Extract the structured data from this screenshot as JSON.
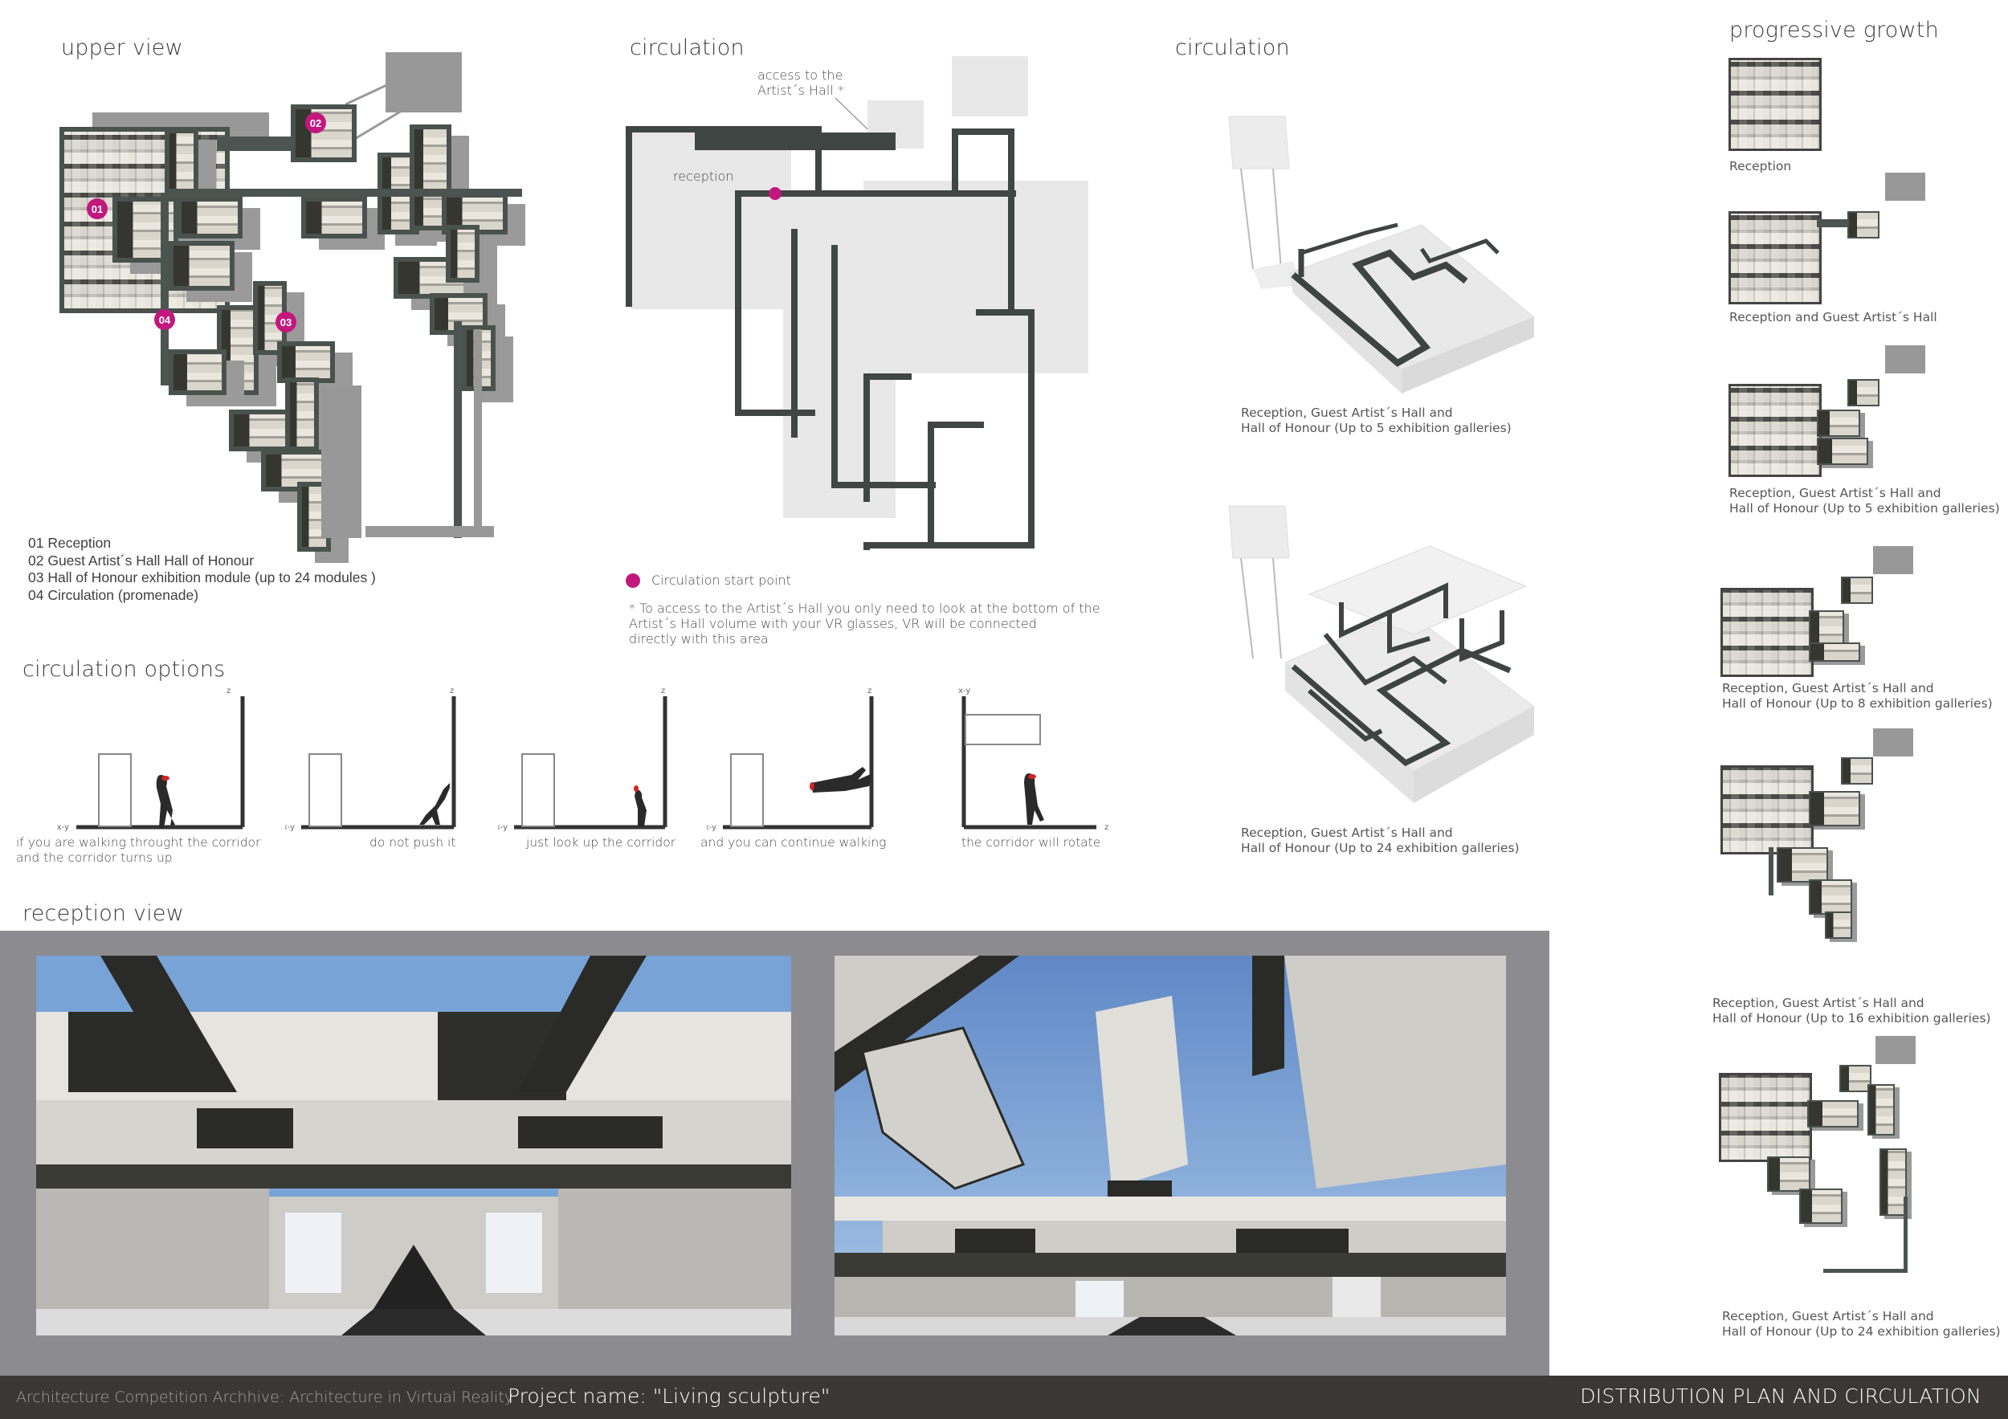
{
  "board": {
    "competition": "Architecture Competition Archhive: Architecture in Virtual Reality",
    "project_name": "Project name: \"Living sculpture\"",
    "sheet_title": "DISTRIBUTION PLAN AND CIRCULATION"
  },
  "upper_view": {
    "title": "upper view",
    "badges": [
      "01",
      "02",
      "03",
      "04"
    ],
    "legend": [
      "01 Reception",
      "02 Guest Artist´s Hall Hall of Honour",
      "03 Hall of Honour exhibition module (up to 24 modules )",
      "04 Circulation (promenade)"
    ]
  },
  "circulation_plan": {
    "title": "circulation",
    "access_label_line1": "access to the",
    "access_label_line2": "Artist´s Hall *",
    "reception_label": "reception",
    "start_point_legend": "Circulation start point",
    "footnote_line1": "* To access to the Artist´s Hall you only need to look at the bottom of the",
    "footnote_line2": "Artist´s Hall volume with your VR glasses, VR will be connected",
    "footnote_line3": "directly with this area",
    "accent_color": "#c2187d"
  },
  "circulation_iso": {
    "title": "circulation",
    "views": [
      {
        "line1": "Reception, Guest Artist´s Hall and",
        "line2": "Hall of Honour (Up to 5 exhibition galleries)"
      },
      {
        "line1": "Reception, Guest Artist´s Hall and",
        "line2": "Hall of Honour (Up to 24 exhibition galleries)"
      }
    ]
  },
  "circulation_options": {
    "title": "circulation options",
    "axis_z": "z",
    "axis_xy": "x-y",
    "steps": [
      {
        "line1": "if you are walking throught the corridor",
        "line2": "and the corridor turns up"
      },
      {
        "line1": "do not push it",
        "line2": ""
      },
      {
        "line1": "just look up the corridor",
        "line2": ""
      },
      {
        "line1": "and you can continue walking",
        "line2": ""
      },
      {
        "line1": "the corridor will rotate",
        "line2": ""
      }
    ]
  },
  "reception_view": {
    "title": "reception view"
  },
  "progressive_growth": {
    "title": "progressive growth",
    "stages": [
      {
        "line1": "Reception",
        "line2": ""
      },
      {
        "line1": "Reception and Guest Artist´s Hall",
        "line2": ""
      },
      {
        "line1": "Reception, Guest Artist´s Hall and",
        "line2": "Hall of Honour (Up to 5 exhibition galleries)"
      },
      {
        "line1": "Reception, Guest Artist´s Hall and",
        "line2": "Hall of Honour (Up to 8 exhibition galleries)"
      },
      {
        "line1": "Reception, Guest Artist´s Hall and",
        "line2": "Hall of Honour (Up to 16 exhibition galleries)"
      },
      {
        "line1": "Reception, Guest Artist´s Hall and",
        "line2": "Hall of Honour (Up to 24 exhibition galleries)"
      }
    ]
  }
}
